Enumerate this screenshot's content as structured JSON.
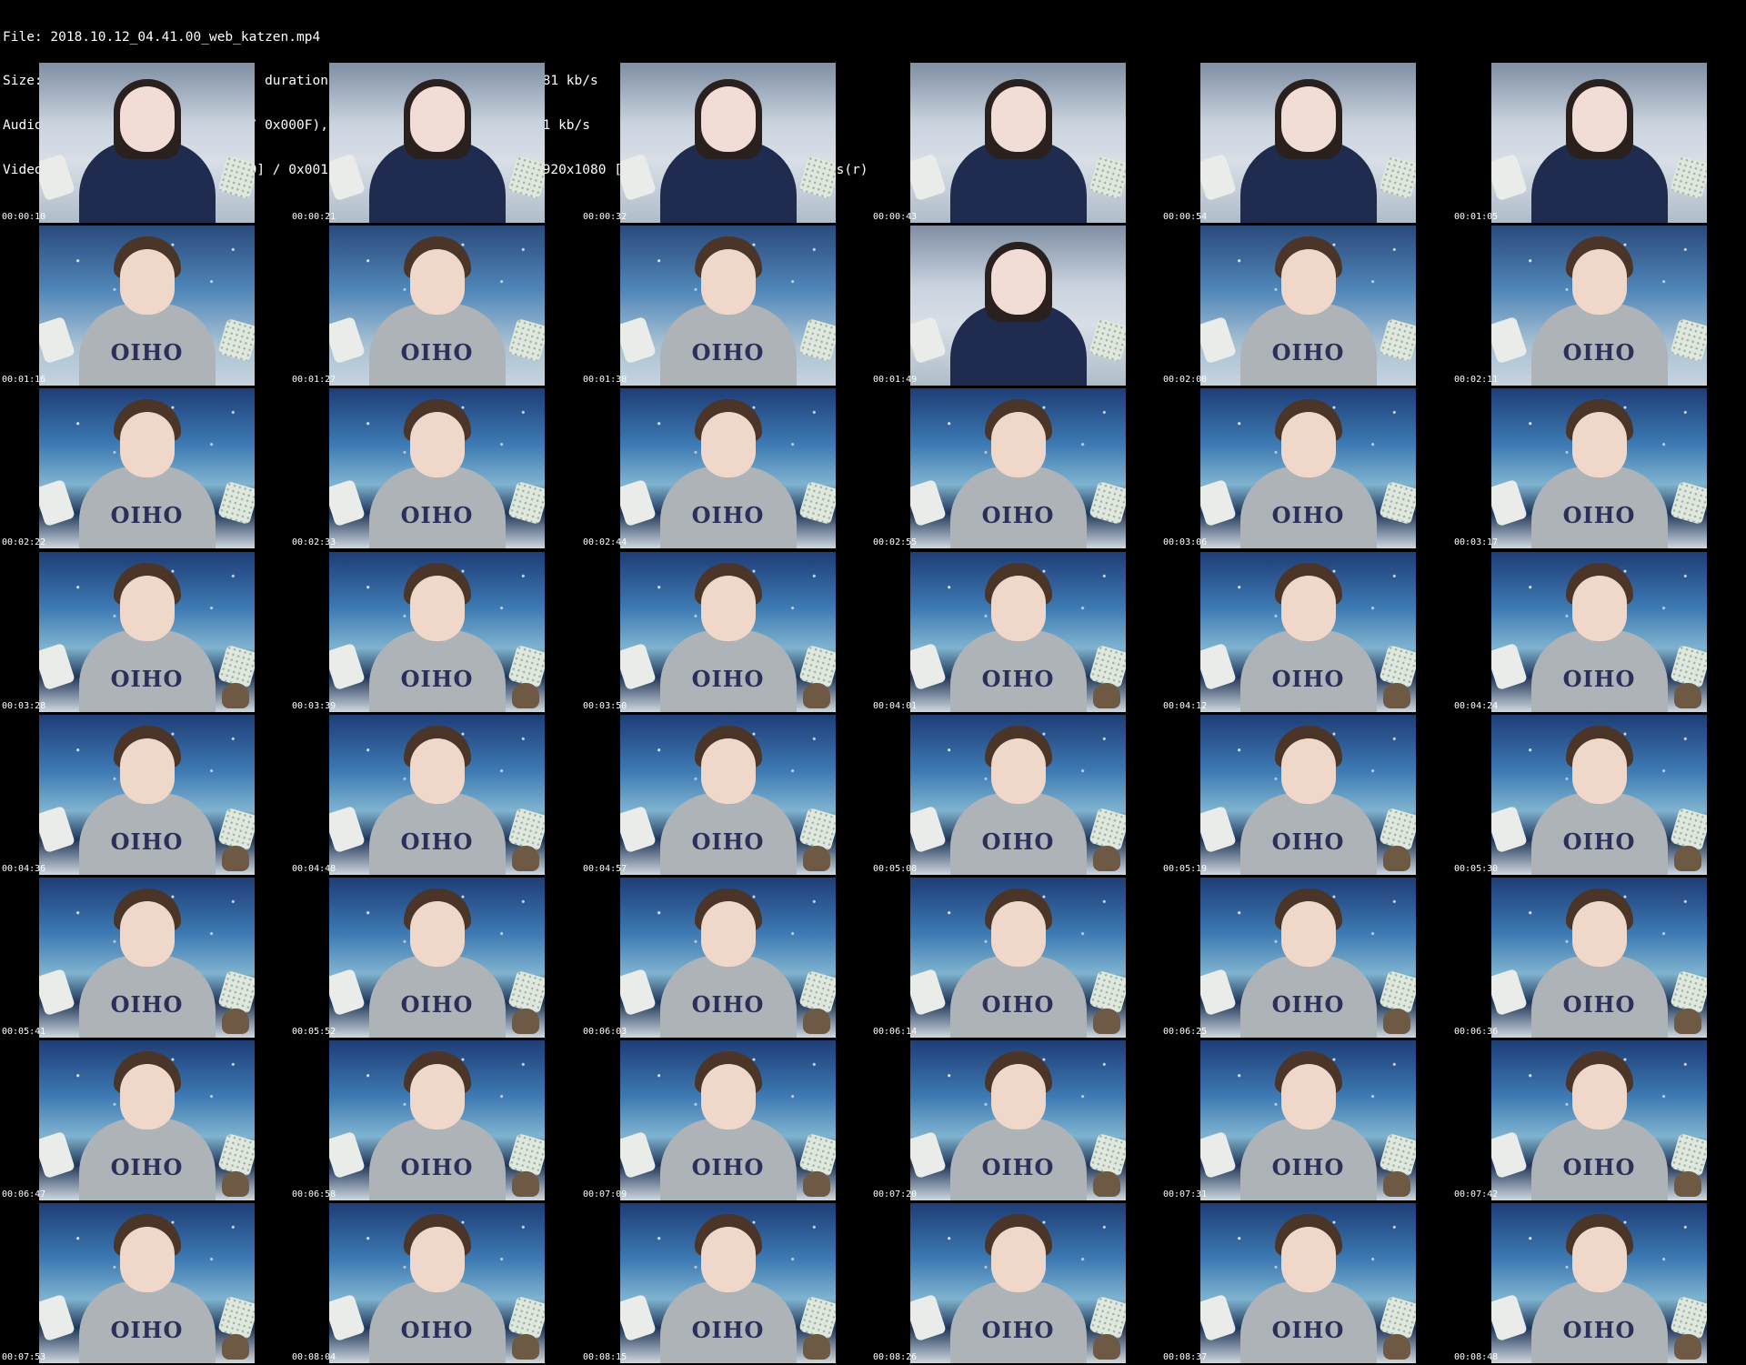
{
  "header": {
    "file_line": "File: 2018.10.12_04.41.00_web_katzen.mp4",
    "size_line": "Size: 368971432 bytes (352 MiB), duration: 00:09:41, avg.bitrate: 5081 kb/s",
    "audio_line": "Audio: aac (LC) ([15][0][0][0] / 0x000F), 44100 Hz, stereo, fltp, 131 kb/s",
    "video_line": "Video: h264 (High) ([27][0][0][0] / 0x001B), yuv420p(progressive), 1920x1080 [SAR 1:1 DAR 16:9], 30.00 fps(r)"
  },
  "thumbnails": [
    {
      "time": "00:00:10",
      "scene": "girl"
    },
    {
      "time": "00:00:21",
      "scene": "girl"
    },
    {
      "time": "00:00:32",
      "scene": "girl"
    },
    {
      "time": "00:00:43",
      "scene": "girl"
    },
    {
      "time": "00:00:54",
      "scene": "girl"
    },
    {
      "time": "00:01:05",
      "scene": "girl"
    },
    {
      "time": "00:01:16",
      "scene": "mix"
    },
    {
      "time": "00:01:27",
      "scene": "mix"
    },
    {
      "time": "00:01:38",
      "scene": "mix"
    },
    {
      "time": "00:01:49",
      "scene": "girl"
    },
    {
      "time": "00:02:00",
      "scene": "mix"
    },
    {
      "time": "00:02:11",
      "scene": "mix"
    },
    {
      "time": "00:02:22",
      "scene": "boy"
    },
    {
      "time": "00:02:33",
      "scene": "boy"
    },
    {
      "time": "00:02:44",
      "scene": "boy"
    },
    {
      "time": "00:02:55",
      "scene": "boy"
    },
    {
      "time": "00:03:06",
      "scene": "boy"
    },
    {
      "time": "00:03:17",
      "scene": "boy"
    },
    {
      "time": "00:03:28",
      "scene": "boy"
    },
    {
      "time": "00:03:39",
      "scene": "boy"
    },
    {
      "time": "00:03:50",
      "scene": "boy"
    },
    {
      "time": "00:04:01",
      "scene": "boy"
    },
    {
      "time": "00:04:12",
      "scene": "boy"
    },
    {
      "time": "00:04:24",
      "scene": "boy"
    },
    {
      "time": "00:04:36",
      "scene": "boy"
    },
    {
      "time": "00:04:48",
      "scene": "boy"
    },
    {
      "time": "00:04:57",
      "scene": "boy"
    },
    {
      "time": "00:05:08",
      "scene": "boy"
    },
    {
      "time": "00:05:19",
      "scene": "boy"
    },
    {
      "time": "00:05:30",
      "scene": "boy"
    },
    {
      "time": "00:05:41",
      "scene": "boy"
    },
    {
      "time": "00:05:52",
      "scene": "boy"
    },
    {
      "time": "00:06:03",
      "scene": "boy"
    },
    {
      "time": "00:06:14",
      "scene": "boy"
    },
    {
      "time": "00:06:25",
      "scene": "boy"
    },
    {
      "time": "00:06:36",
      "scene": "boy"
    },
    {
      "time": "00:06:47",
      "scene": "boy"
    },
    {
      "time": "00:06:58",
      "scene": "boy"
    },
    {
      "time": "00:07:09",
      "scene": "boy"
    },
    {
      "time": "00:07:20",
      "scene": "boy"
    },
    {
      "time": "00:07:31",
      "scene": "boy"
    },
    {
      "time": "00:07:42",
      "scene": "boy"
    },
    {
      "time": "00:07:53",
      "scene": "boy"
    },
    {
      "time": "00:08:04",
      "scene": "boy"
    },
    {
      "time": "00:08:15",
      "scene": "boy"
    },
    {
      "time": "00:08:26",
      "scene": "boy"
    },
    {
      "time": "00:08:37",
      "scene": "boy"
    },
    {
      "time": "00:08:48",
      "scene": "boy"
    }
  ],
  "shirt_text": "OIHO",
  "colors": {
    "background": "#000000",
    "text": "#ffffff"
  }
}
